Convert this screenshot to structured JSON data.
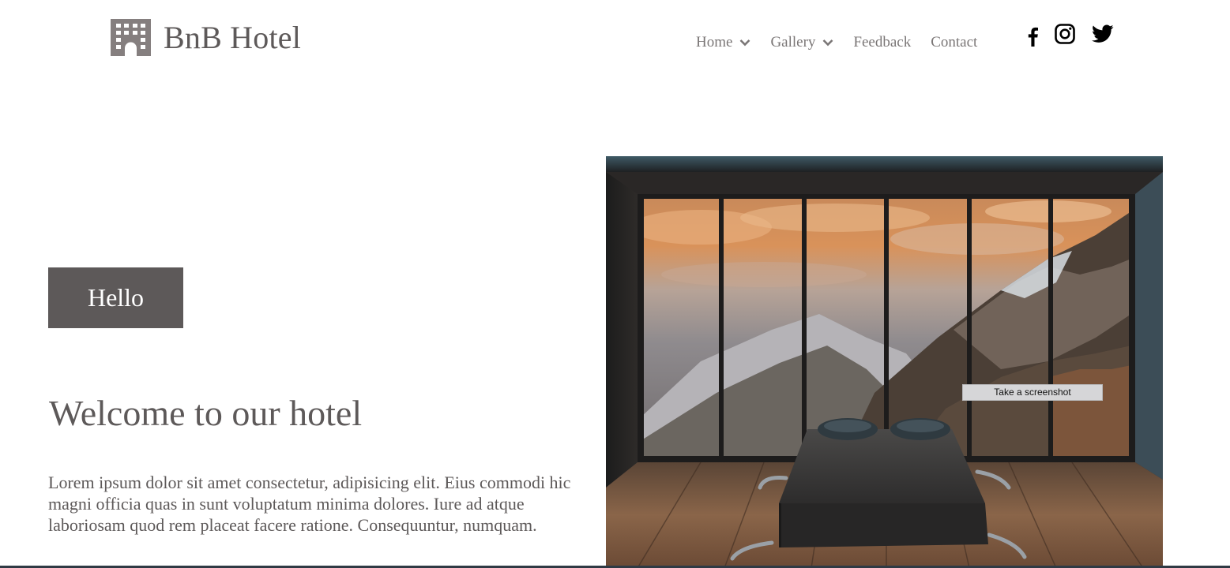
{
  "brand": {
    "name": "BnB Hotel",
    "icon": "hotel-building-icon"
  },
  "nav": {
    "items": [
      {
        "label": "Home",
        "has_dropdown": true
      },
      {
        "label": "Gallery",
        "has_dropdown": true
      },
      {
        "label": "Feedback",
        "has_dropdown": false
      },
      {
        "label": "Contact",
        "has_dropdown": false
      }
    ]
  },
  "social": {
    "icons": [
      "facebook-icon",
      "instagram-icon",
      "twitter-icon"
    ]
  },
  "hero": {
    "button_label": "Hello",
    "title": "Welcome to our hotel",
    "body": "Lorem ipsum dolor sit amet consectetur, adipisicing elit. Eius commodi hic magni officia quas in sunt voluptatum minima dolores. Iure ad atque laboriosam quod rem placeat facere ratione. Consequuntur, numquam."
  },
  "tooltip": {
    "text": "Take a screenshot"
  },
  "colors": {
    "text": "#5d5959",
    "nav": "#7a7676",
    "button_bg": "#5d5959",
    "button_text": "#ffffff"
  }
}
